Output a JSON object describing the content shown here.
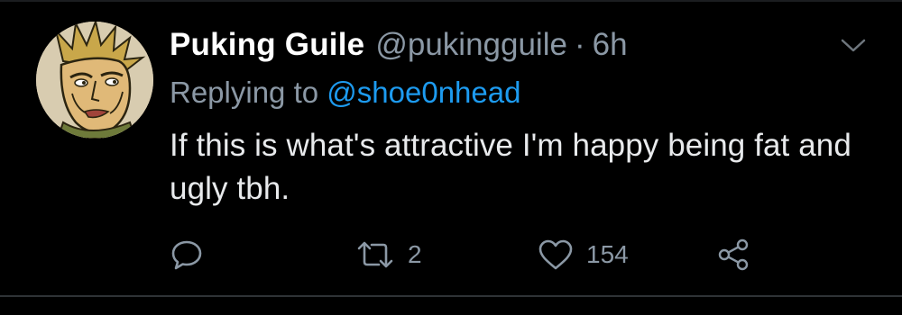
{
  "tweet": {
    "display_name": "Puking Guile",
    "handle": "@pukingguile",
    "separator": "·",
    "time": "6h",
    "replying_to_label": "Replying to",
    "replying_to_handle": "@shoe0nhead",
    "text": "If this is what's attractive I'm happy being fat and ugly tbh.",
    "actions": {
      "reply": {
        "icon": "comment-icon",
        "count": ""
      },
      "retweet": {
        "icon": "retweet-icon",
        "count": "2"
      },
      "like": {
        "icon": "heart-icon",
        "count": "154"
      },
      "share": {
        "icon": "share-icon",
        "count": ""
      }
    }
  },
  "colors": {
    "background": "#000000",
    "primary_text": "#ffffff",
    "secondary_text": "#8b98a5",
    "accent": "#1d9bf0"
  }
}
